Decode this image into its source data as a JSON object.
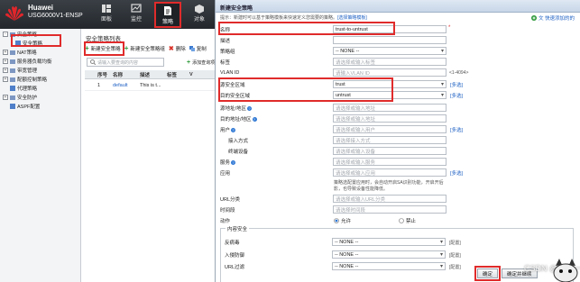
{
  "brand": {
    "name": "Huawei",
    "model": "USG6000V1-ENSP"
  },
  "topnav": [
    {
      "label": "面板",
      "icon": "dashboard-icon"
    },
    {
      "label": "监控",
      "icon": "monitor-icon"
    },
    {
      "label": "策略",
      "icon": "policy-icon",
      "active": true
    },
    {
      "label": "对象",
      "icon": "object-icon"
    }
  ],
  "tree": [
    {
      "label": "安全策略",
      "toggle": "-"
    },
    {
      "label": "安全策略",
      "selected": true
    },
    {
      "label": "NAT策略",
      "toggle": "+"
    },
    {
      "label": "服务器负载均衡",
      "toggle": "+"
    },
    {
      "label": "带宽管理",
      "toggle": "+"
    },
    {
      "label": "配额控制策略",
      "toggle": "+"
    },
    {
      "label": "代理策略"
    },
    {
      "label": "安全防护",
      "toggle": "+"
    },
    {
      "label": "ASPF配置"
    }
  ],
  "list": {
    "title": "安全策略列表",
    "toolbar": {
      "new": "新建安全策略",
      "new_group": "新建安全策略组",
      "delete": "删除",
      "copy": "复制"
    },
    "search_placeholder": "请输入要查询的内容",
    "add_filter": "添加查询项",
    "columns": [
      "序号",
      "名称",
      "描述",
      "标签",
      "V"
    ],
    "rows": [
      {
        "seq": "1",
        "name": "default",
        "desc": "This is t..."
      }
    ]
  },
  "dialog": {
    "title": "新建安全策略",
    "hint_prefix": "提示：新建时可以基于策略模板来快速定义您需要的策略。",
    "hint_link": "[选择策略模板]",
    "wizard": "文 快速添加的的",
    "multi": "[多选]",
    "fields": {
      "name": {
        "label": "名称",
        "value": "trust-to-untrust"
      },
      "desc": {
        "label": "描述",
        "value": ""
      },
      "group": {
        "label": "策略组",
        "value": "-- NONE --"
      },
      "tag": {
        "label": "标签",
        "placeholder": "请选择或输入标签"
      },
      "vlan": {
        "label": "VLAN ID",
        "placeholder": "请输入VLAN ID",
        "range": "<1-4094>"
      },
      "src_zone": {
        "label": "源安全区域",
        "value": "trust"
      },
      "dst_zone": {
        "label": "目的安全区域",
        "value": "untrust"
      },
      "src_addr": {
        "label": "源地址/地区",
        "placeholder": "请选择或输入地址"
      },
      "dst_addr": {
        "label": "目的地址/地区",
        "placeholder": "请选择或输入地址"
      },
      "user": {
        "label": "用户",
        "placeholder": "请选择或输入用户"
      },
      "access": {
        "label": "接入方式",
        "placeholder": "请选择接入方式"
      },
      "terminal": {
        "label": "终端设备",
        "placeholder": "请选择或输入设备"
      },
      "service": {
        "label": "服务",
        "placeholder": "请选择或输入服务"
      },
      "app": {
        "label": "应用",
        "placeholder": "请选择或输入应用"
      },
      "app_note_1": "策略选配置应用时，会自动开启SA识别功能，开启开后",
      "app_note_2": "影，也导致设备性能降低。",
      "url": {
        "label": "URL分类",
        "placeholder": "请选择或输入URL分类"
      },
      "time": {
        "label": "时间段",
        "placeholder": "请选择时间段"
      },
      "action": {
        "label": "动作",
        "permit": "允许",
        "deny": "禁止"
      }
    },
    "content_security": {
      "legend": "内容安全",
      "antivirus": {
        "label": "反病毒",
        "value": "-- NONE --",
        "config": "[配置]"
      },
      "ips": {
        "label": "入侵防御",
        "value": "-- NONE --",
        "config": "[配置]"
      },
      "url_filter": {
        "label": "URL过滤",
        "value": "-- NONE --",
        "config": "[配置]"
      }
    },
    "buttons": {
      "ok": "确定",
      "ok_continue": "确定并继续"
    }
  },
  "watermark": "CSDN @雨天一"
}
